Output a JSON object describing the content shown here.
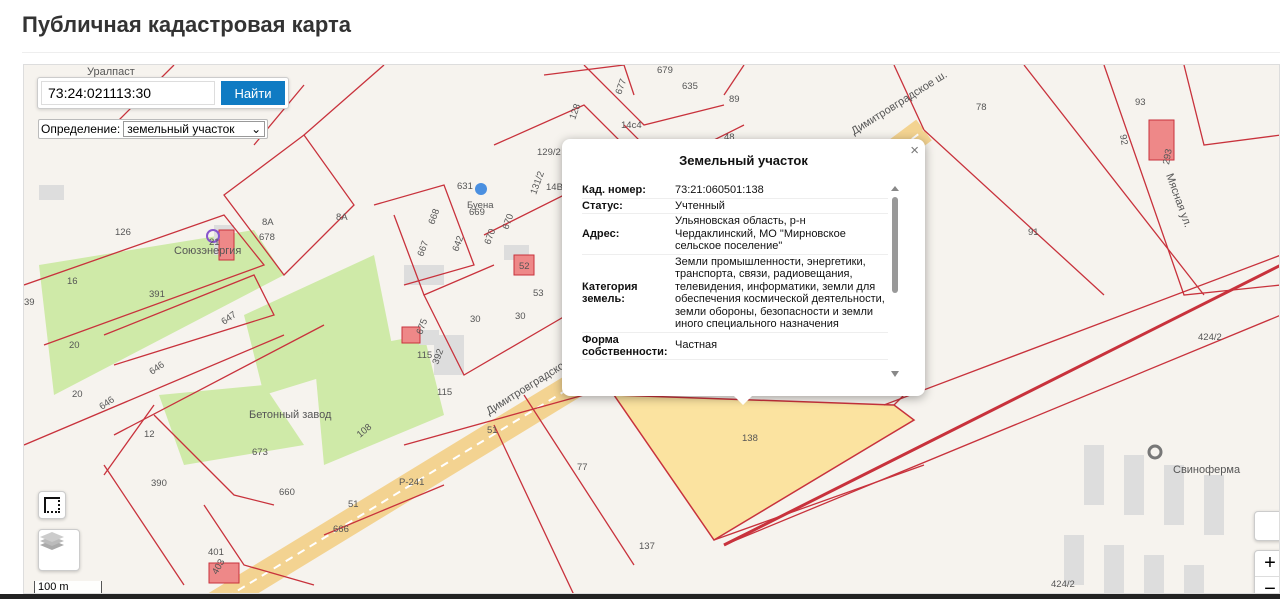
{
  "page_title": "Публичная кадастровая карта",
  "search": {
    "value": "73:24:021113:30",
    "button": "Найти"
  },
  "definition": {
    "label": "Определение:",
    "selected": "земельный участок"
  },
  "scale": "100 m",
  "zoom": {
    "in": "+",
    "out": "−"
  },
  "popup": {
    "title": "Земельный участок",
    "close": "×",
    "rows": [
      {
        "key": "Кад. номер:",
        "value": "73:21:060501:138"
      },
      {
        "key": "Статус:",
        "value": "Учтенный"
      },
      {
        "key": "Адрес:",
        "value": "Ульяновская область, р-н Чердаклинский, МО \"Мирновское сельское поселение\""
      },
      {
        "key": "Категория земель:",
        "value": "Земли промышленности, энергетики, транспорта, связи, радиовещания, телевидения, информатики, земли для обеспечения космической деятельности, земли обороны, безопасности и земли иного специального назначения"
      },
      {
        "key": "Форма собственности:",
        "value": "Частная"
      }
    ]
  },
  "map": {
    "labels": [
      "Уралпаст",
      "679",
      "126",
      "8А",
      "8А",
      "678",
      "Союзэнергия",
      "21",
      "16",
      "391",
      "39",
      "647",
      "20",
      "646",
      "646",
      "20",
      "Бетонный завод",
      "12",
      "673",
      "390",
      "660",
      "401",
      "403",
      "666",
      "108",
      "115",
      "392",
      "115",
      "675",
      "30",
      "30",
      "631",
      "669",
      "Буена",
      "668",
      "667",
      "642",
      "670",
      "670",
      "52",
      "53",
      "129/2",
      "131/2",
      "14В",
      "128",
      "677",
      "635",
      "89",
      "14с4",
      "48",
      "Димитровградское ш.",
      "Димитровградское",
      "78",
      "91",
      "93",
      "293",
      "Мясная ул.",
      "92",
      "424/2",
      "424/2",
      "138",
      "77",
      "137",
      "Свиноферма",
      "Р-241",
      "51",
      "51"
    ],
    "colors": {
      "parcel_border": "#c8323c",
      "selected_fill": "#fbe3a0",
      "green": "#cfeaa8",
      "road": "#f2c46a"
    }
  }
}
